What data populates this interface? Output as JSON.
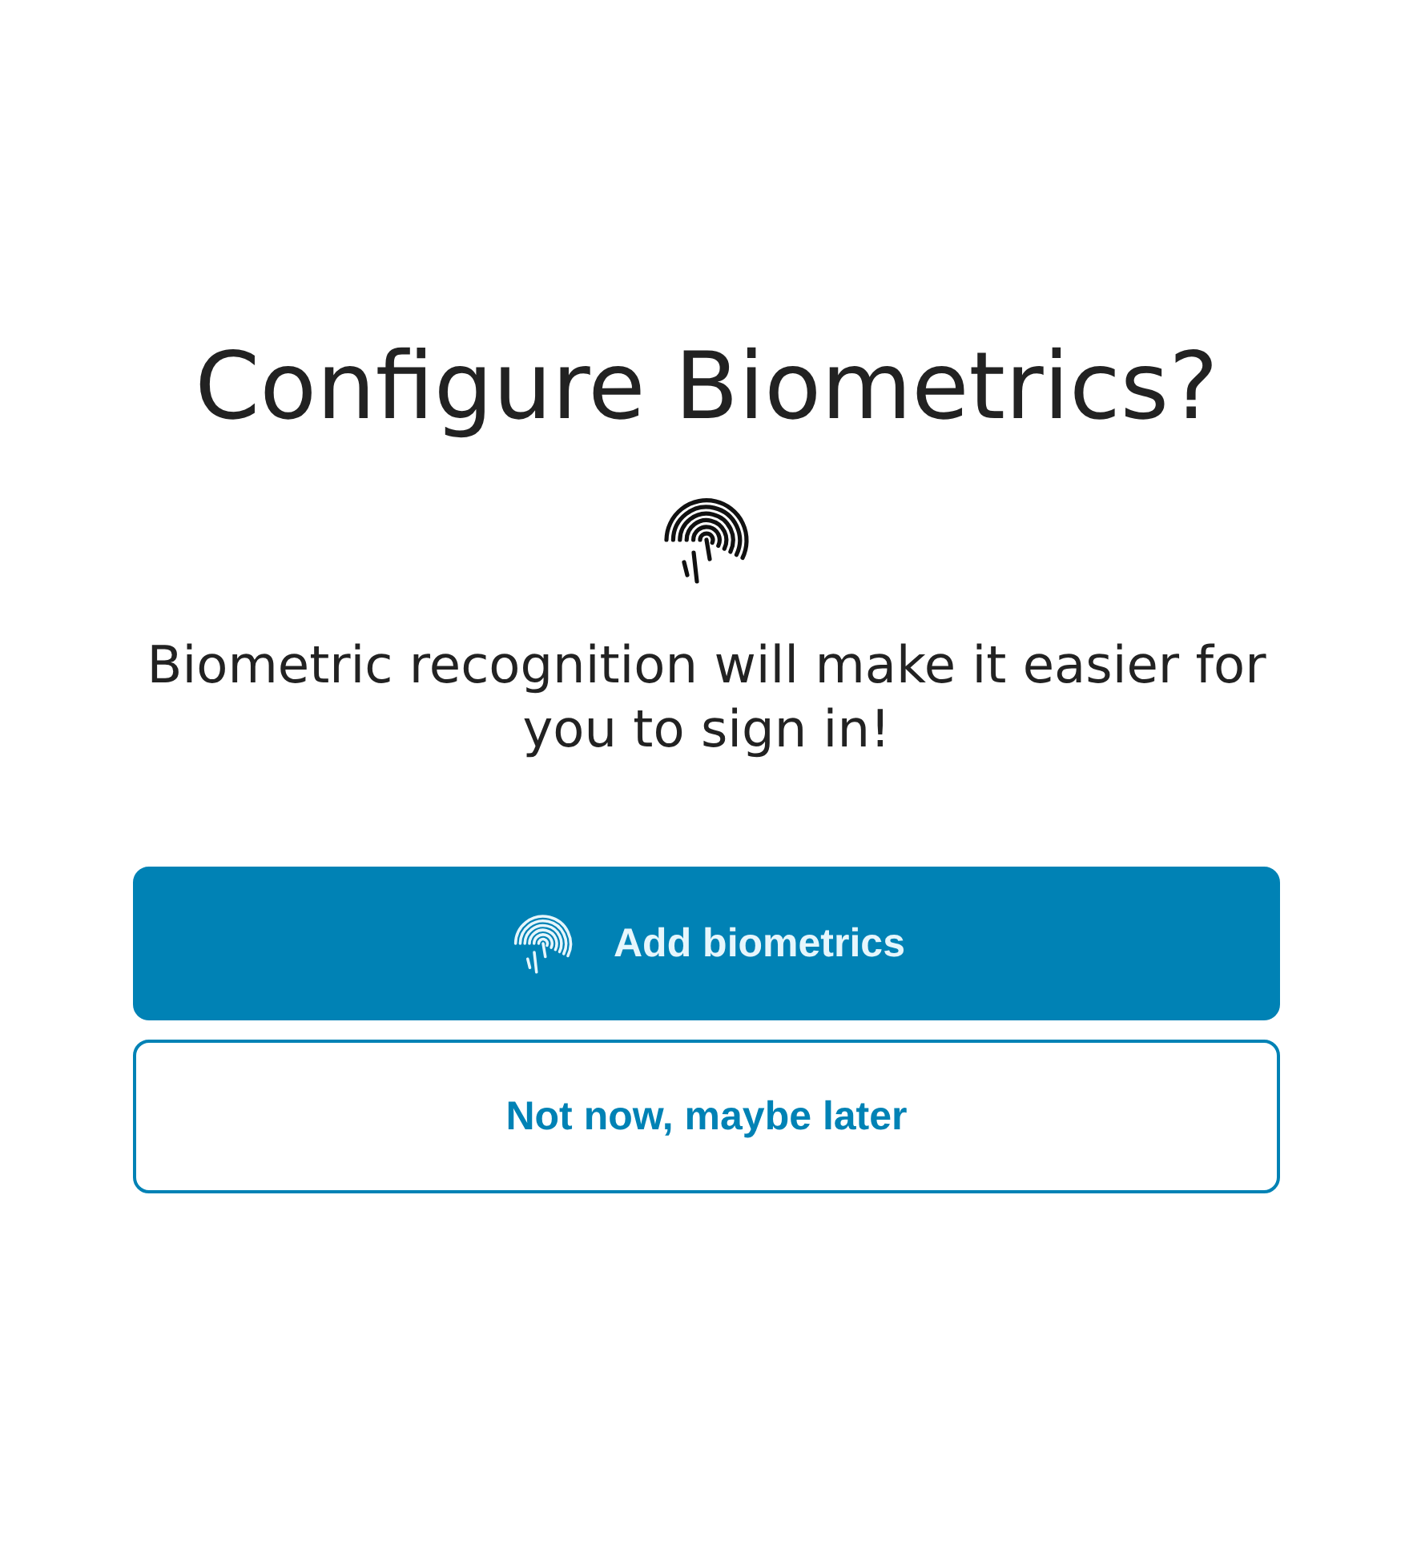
{
  "title": "Configure Biometrics?",
  "message": "Biometric recognition will make it easier for you to sign in!",
  "buttons": [
    {
      "label": "Add biometrics",
      "kind": "primary"
    },
    {
      "label": "Not now, maybe later",
      "kind": "secondary"
    }
  ]
}
